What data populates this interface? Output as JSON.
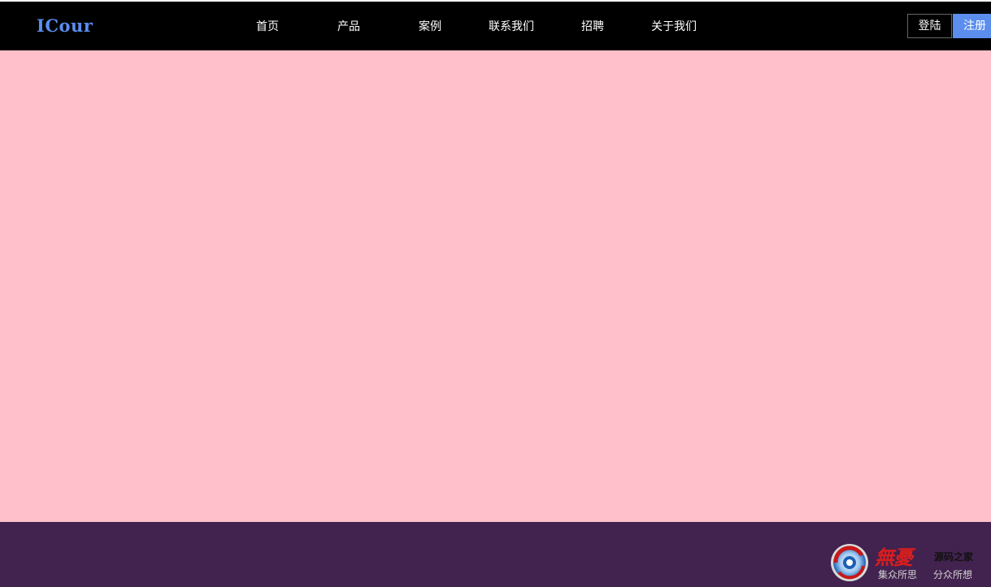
{
  "header": {
    "logo": "ICour",
    "nav": [
      {
        "label": "首页"
      },
      {
        "label": "产品"
      },
      {
        "label": "案例"
      },
      {
        "label": "联系我们"
      },
      {
        "label": "招聘"
      },
      {
        "label": "关于我们"
      }
    ],
    "login_label": "登陆",
    "register_label": "注册"
  },
  "colors": {
    "navbar_bg": "#000000",
    "accent": "#5b8def",
    "main_bg": "#ffc0cb",
    "footer_bg": "#42224f"
  },
  "watermark": {
    "brand": "無憂",
    "site": "源码之家",
    "slogan_left": "集众所思",
    "slogan_right": "分众所想"
  }
}
